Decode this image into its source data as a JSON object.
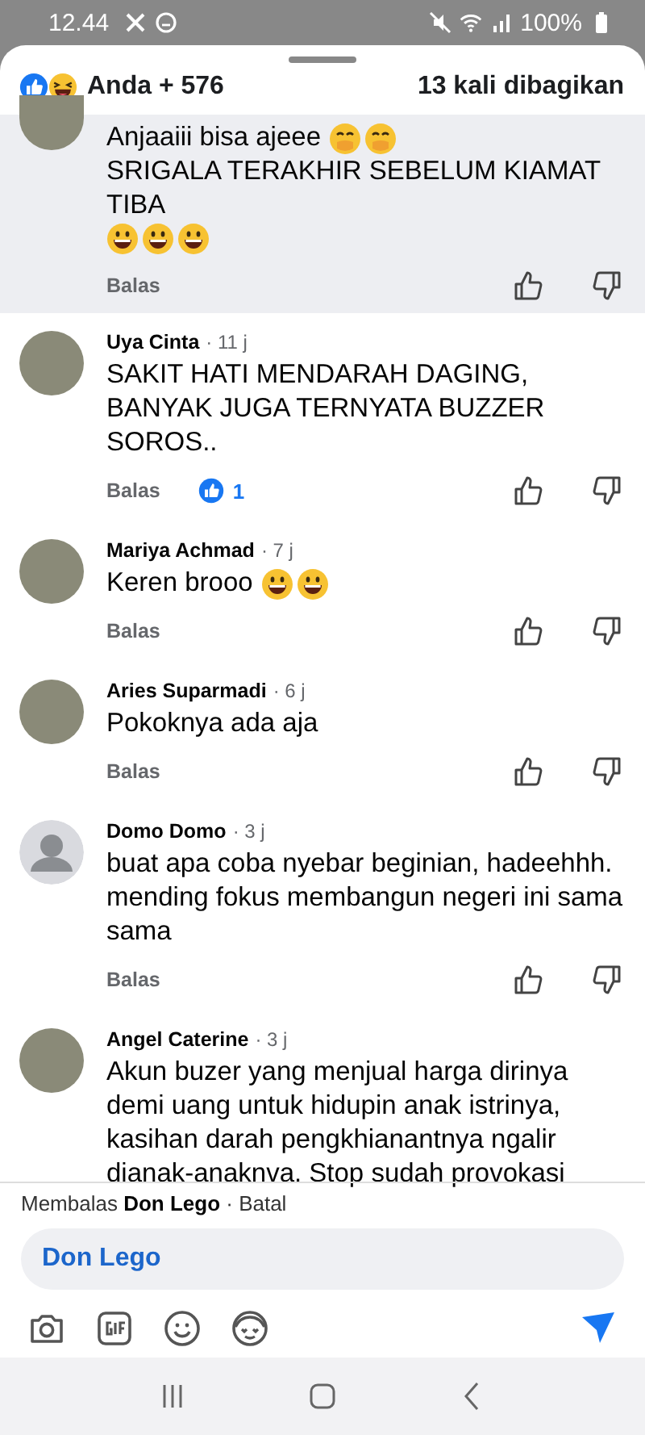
{
  "status_bar": {
    "time": "12.44",
    "battery": "100%"
  },
  "header": {
    "reactions_label": "Anda + 576",
    "shares": "13 kali dibagikan"
  },
  "comments": [
    {
      "highlighted": true,
      "avatar": {
        "kind": "photo"
      },
      "body": [
        {
          "text": "Anjaaiii bisa ajeee",
          "emojis": [
            {
              "kind": "shush"
            },
            {
              "kind": "shush"
            }
          ]
        },
        {
          "text": "SRIGALA TERAKHIR SEBELUM KIAMAT TIBA"
        },
        {
          "emojis": [
            {
              "kind": "grin"
            },
            {
              "kind": "grin"
            },
            {
              "kind": "grin"
            }
          ]
        }
      ],
      "reply": "Balas"
    },
    {
      "author": "Uya Cinta",
      "time": "· 11 j",
      "highlighted": false,
      "avatar": {
        "kind": "photo"
      },
      "body": [
        {
          "text": "SAKIT HATI MENDARAH DAGING, BANYAK JUGA TERNYATA BUZZER SOROS.."
        }
      ],
      "reply": "Balas",
      "likes": "1"
    },
    {
      "author": "Mariya Achmad",
      "time": "· 7 j",
      "highlighted": false,
      "avatar": {
        "kind": "photo"
      },
      "body": [
        {
          "text": "Keren brooo",
          "emojis": [
            {
              "kind": "grin"
            },
            {
              "kind": "grin"
            }
          ]
        }
      ],
      "reply": "Balas"
    },
    {
      "author": "Aries Suparmadi",
      "time": "· 6 j",
      "highlighted": false,
      "avatar": {
        "kind": "photo"
      },
      "body": [
        {
          "text": "Pokoknya ada aja"
        }
      ],
      "reply": "Balas"
    },
    {
      "author": "Domo Domo",
      "time": "· 3 j",
      "highlighted": false,
      "avatar": {
        "kind": "default"
      },
      "body": [
        {
          "text": "buat apa coba nyebar beginian, hadeehhh. mending fokus membangun negeri ini sama sama"
        }
      ],
      "reply": "Balas"
    },
    {
      "author": "Angel Caterine",
      "time": "· 3 j",
      "highlighted": false,
      "avatar": {
        "kind": "photo"
      },
      "body": [
        {
          "text": "Akun buzer yang menjual harga dirinya demi uang untuk hidupin anak istrinya, kasihan darah pengkhianantnya ngalir dianak-anaknva. Stop sudah provokasi"
        }
      ]
    }
  ],
  "composer": {
    "replying_to": "Membalas **Don Lego** · Batal",
    "value": "Don Lego"
  }
}
